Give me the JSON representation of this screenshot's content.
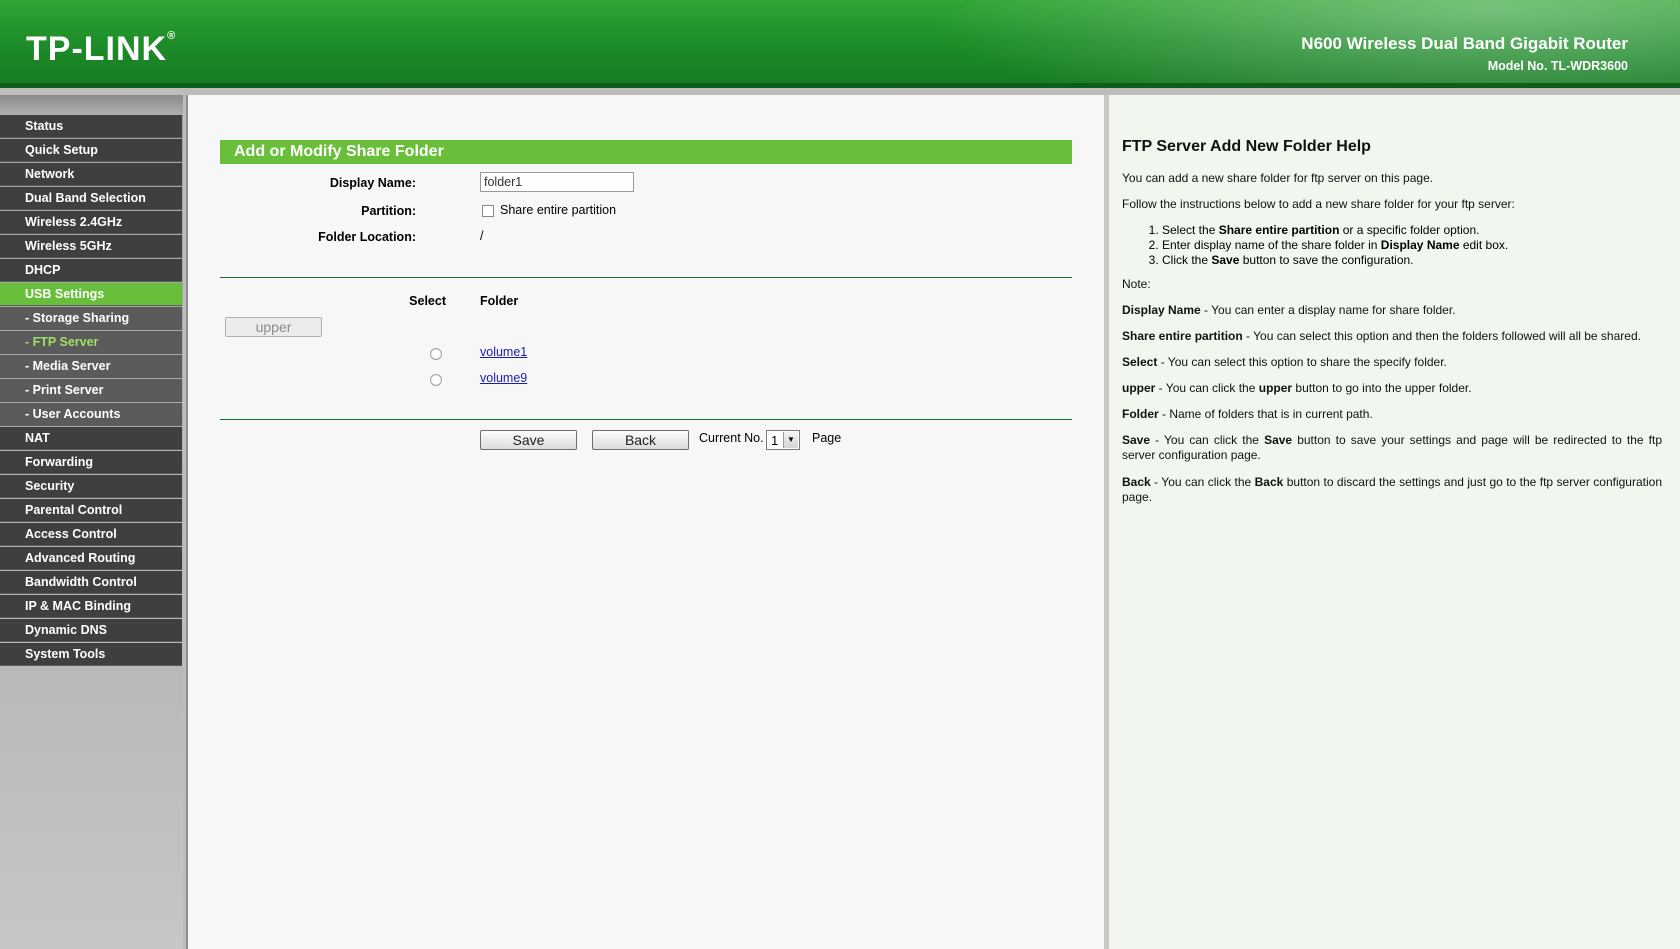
{
  "header": {
    "logo": "TP-LINK",
    "logo_mark": "®",
    "product": "N600 Wireless Dual Band Gigabit Router",
    "model": "Model No. TL-WDR3600"
  },
  "sidebar": {
    "items": [
      {
        "label": "Status",
        "sub": false,
        "active": false
      },
      {
        "label": "Quick Setup",
        "sub": false,
        "active": false
      },
      {
        "label": "Network",
        "sub": false,
        "active": false
      },
      {
        "label": "Dual Band Selection",
        "sub": false,
        "active": false
      },
      {
        "label": "Wireless 2.4GHz",
        "sub": false,
        "active": false
      },
      {
        "label": "Wireless 5GHz",
        "sub": false,
        "active": false
      },
      {
        "label": "DHCP",
        "sub": false,
        "active": false
      },
      {
        "label": "USB Settings",
        "sub": false,
        "active": true
      },
      {
        "label": "- Storage Sharing",
        "sub": true,
        "active": false
      },
      {
        "label": "- FTP Server",
        "sub": true,
        "active": true
      },
      {
        "label": "- Media Server",
        "sub": true,
        "active": false
      },
      {
        "label": "- Print Server",
        "sub": true,
        "active": false
      },
      {
        "label": "- User Accounts",
        "sub": true,
        "active": false
      },
      {
        "label": "NAT",
        "sub": false,
        "active": false
      },
      {
        "label": "Forwarding",
        "sub": false,
        "active": false
      },
      {
        "label": "Security",
        "sub": false,
        "active": false
      },
      {
        "label": "Parental Control",
        "sub": false,
        "active": false
      },
      {
        "label": "Access Control",
        "sub": false,
        "active": false
      },
      {
        "label": "Advanced Routing",
        "sub": false,
        "active": false
      },
      {
        "label": "Bandwidth Control",
        "sub": false,
        "active": false
      },
      {
        "label": "IP & MAC Binding",
        "sub": false,
        "active": false
      },
      {
        "label": "Dynamic DNS",
        "sub": false,
        "active": false
      },
      {
        "label": "System Tools",
        "sub": false,
        "active": false
      }
    ]
  },
  "main": {
    "title": "Add or Modify Share Folder",
    "display_name_label": "Display Name:",
    "display_name_value": "folder1",
    "partition_label": "Partition:",
    "share_entire_label": "Share entire partition",
    "folder_location_label": "Folder Location:",
    "folder_location_value": "/",
    "select_header": "Select",
    "folder_header": "Folder",
    "upper_button": "upper",
    "folders": [
      "volume1",
      "volume9"
    ],
    "save_button": "Save",
    "back_button": "Back",
    "current_no_label": "Current No.",
    "current_no_value": "1",
    "page_label": "Page"
  },
  "help": {
    "title": "FTP Server Add New Folder Help",
    "intro": "You can add a new share folder for ftp server on this page.",
    "follow": "Follow the instructions below to add a new share folder for your ftp server:",
    "step1_a": "Select the ",
    "step1_b": "Share entire partition",
    "step1_c": " or a specific folder option.",
    "step2_a": "Enter display name of the share folder in ",
    "step2_b": "Display Name",
    "step2_c": " edit box.",
    "step3_a": "Click the ",
    "step3_b": "Save",
    "step3_c": " button to save the configuration.",
    "note": "Note:",
    "n1_b": "Display Name",
    "n1_t": " - You can enter a display name for share folder.",
    "n2_b": "Share entire partition",
    "n2_t": " - You can select this option and then the folders followed will all be shared.",
    "n3_b": "Select",
    "n3_t": " - You can select this option to share the specify folder.",
    "n4_b": "upper",
    "n4_t1": " - You can click the ",
    "n4_b2": "upper",
    "n4_t2": " button to go into the upper folder.",
    "n5_b": "Folder",
    "n5_t": " - Name of folders that is in current path.",
    "n6_b": "Save",
    "n6_t1": " - You can click the ",
    "n6_b2": "Save",
    "n6_t2": " button to save your settings and page will be redirected to the ftp server configuration page.",
    "n7_b": "Back",
    "n7_t1": " - You can click the ",
    "n7_b2": "Back",
    "n7_t2": " button to discard the settings and just go to the ftp server configuration page."
  }
}
